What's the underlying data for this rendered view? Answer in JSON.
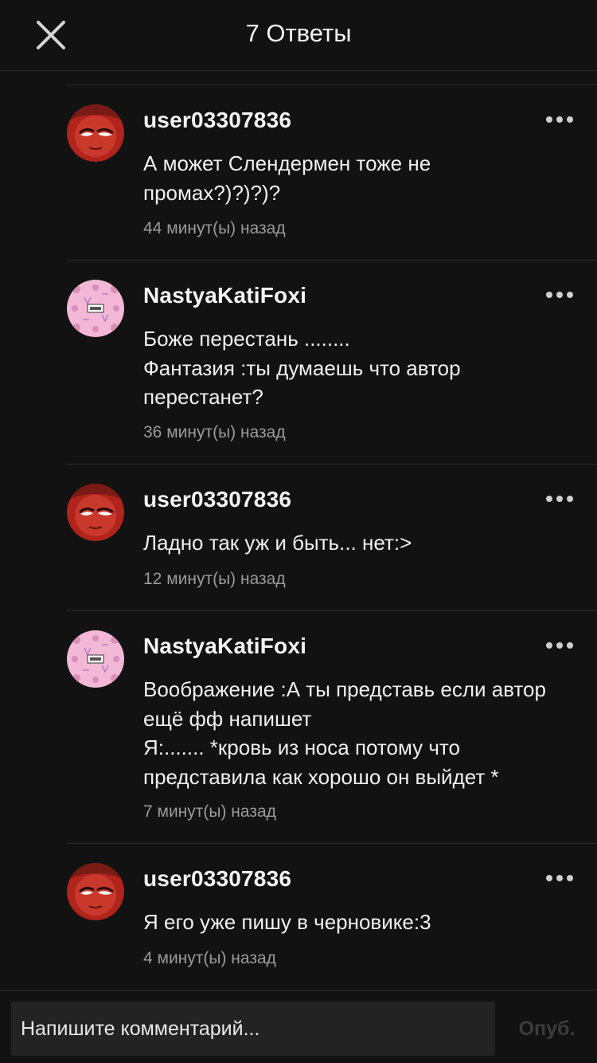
{
  "header": {
    "title": "7 Ответы",
    "close_icon": "close-icon"
  },
  "comments": [
    {
      "username": "user03307836",
      "avatar": "red-character-avatar",
      "text": "А может Слендермен тоже не\nпромах?)?)?)?",
      "time": "44 минут(ы) назад"
    },
    {
      "username": "NastyaKatiFoxi",
      "avatar": "pink-pattern-avatar",
      "text": "Боже перестань ........\nФантазия :ты думаешь что автор\nперестанет?",
      "time": "36 минут(ы) назад"
    },
    {
      "username": "user03307836",
      "avatar": "red-character-avatar",
      "text": "Ладно так уж и быть... нет:>",
      "time": "12 минут(ы) назад"
    },
    {
      "username": "NastyaKatiFoxi",
      "avatar": "pink-pattern-avatar",
      "text": "Воображение :А ты представь если автор\nещё фф напишет\nЯ:....... *кровь из носа потому что\nпредставила как хорошо он выйдет *",
      "time": "7 минут(ы) назад"
    },
    {
      "username": "user03307836",
      "avatar": "red-character-avatar",
      "text": "Я его уже пишу в черновике:3",
      "time": "4 минут(ы) назад"
    }
  ],
  "composer": {
    "placeholder": "Напишите комментарий...",
    "post_label": "Опуб."
  },
  "colors": {
    "background": "#121212",
    "divider": "#2c2c2c",
    "input_background": "#232323",
    "post_button_disabled": "#3c3c3c"
  }
}
